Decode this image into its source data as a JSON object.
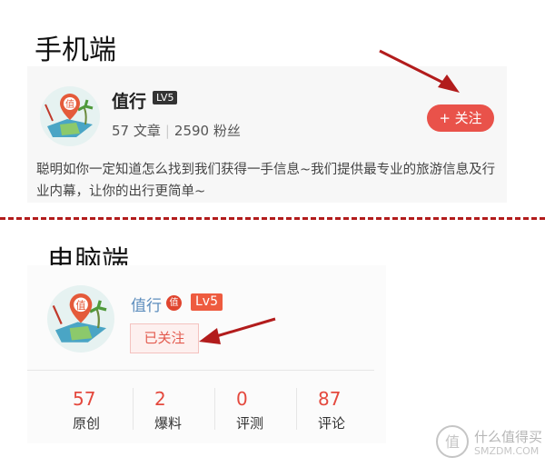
{
  "mobile": {
    "section_title": "手机端",
    "name": "值行",
    "level": "LV5",
    "stats": {
      "articles": "57 文章",
      "fans": "2590 粉丝"
    },
    "follow_label": "+ 关注",
    "description": "聪明如你一定知道怎么找到我们获得一手信息~我们提供最专业的旅游信息及行业内幕，让你的出行更简单~"
  },
  "pc": {
    "section_title": "电脑端",
    "name": "值行",
    "badge": "值",
    "level": "Lv5",
    "followed_label": "已关注",
    "stats": [
      {
        "value": "57",
        "label": "原创"
      },
      {
        "value": "2",
        "label": "爆料"
      },
      {
        "value": "0",
        "label": "评测"
      },
      {
        "value": "87",
        "label": "评论"
      }
    ]
  },
  "watermark": {
    "text": "什么值得买",
    "sub": "SMZDM.COM"
  },
  "colors": {
    "accent_red": "#e9524a",
    "annotation_arrow": "#b21c1c",
    "pc_name": "#5c8dbd"
  }
}
